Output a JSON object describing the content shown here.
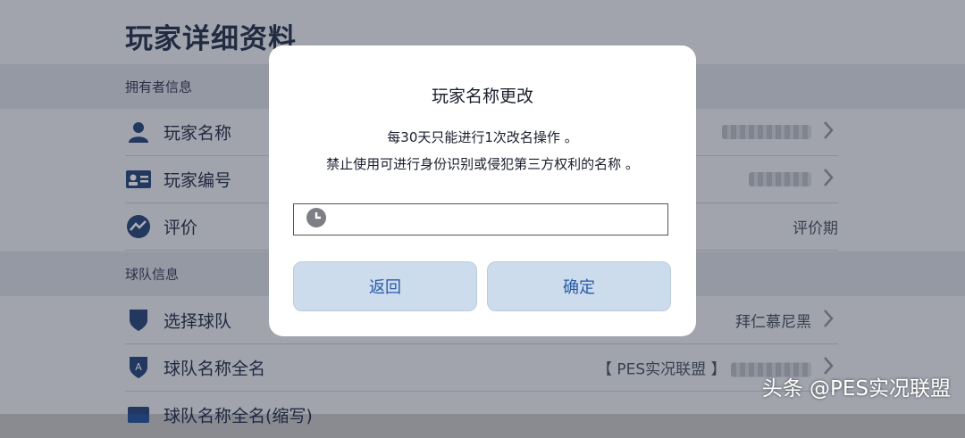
{
  "page": {
    "title": "玩家详细资料"
  },
  "sections": {
    "owner": {
      "label": "拥有者信息",
      "rows": [
        {
          "label": "玩家名称",
          "icon": "person-icon",
          "value": ""
        },
        {
          "label": "玩家编号",
          "icon": "id-card-icon",
          "value": ""
        },
        {
          "label": "评价",
          "icon": "rating-trend-icon",
          "value": "评价期"
        }
      ]
    },
    "team": {
      "label": "球队信息",
      "rows": [
        {
          "label": "选择球队",
          "icon": "shield-icon",
          "value": "拜仁慕尼黑"
        },
        {
          "label": "球队名称全名",
          "icon": "shield-a-icon",
          "value": "【 PES实况联盟 】"
        },
        {
          "label": "球队名称全名(缩写)",
          "icon": "badge-icon",
          "value": ""
        }
      ]
    }
  },
  "dialog": {
    "title": "玩家名称更改",
    "message_line1": "每30天只能进行1次改名操作 。",
    "message_line2": "禁止使用可进行身份识别或侵犯第三方权利的名称 。",
    "input": {
      "value": "",
      "icon": "clock-icon"
    },
    "back_label": "返回",
    "confirm_label": "确定"
  },
  "watermark": "头条 @PES实况联盟",
  "colors": {
    "accent": "#2a5aa6",
    "button_bg": "#ccdcec",
    "icon_navy": "#1f3f75",
    "title_navy": "#1d2a45"
  }
}
